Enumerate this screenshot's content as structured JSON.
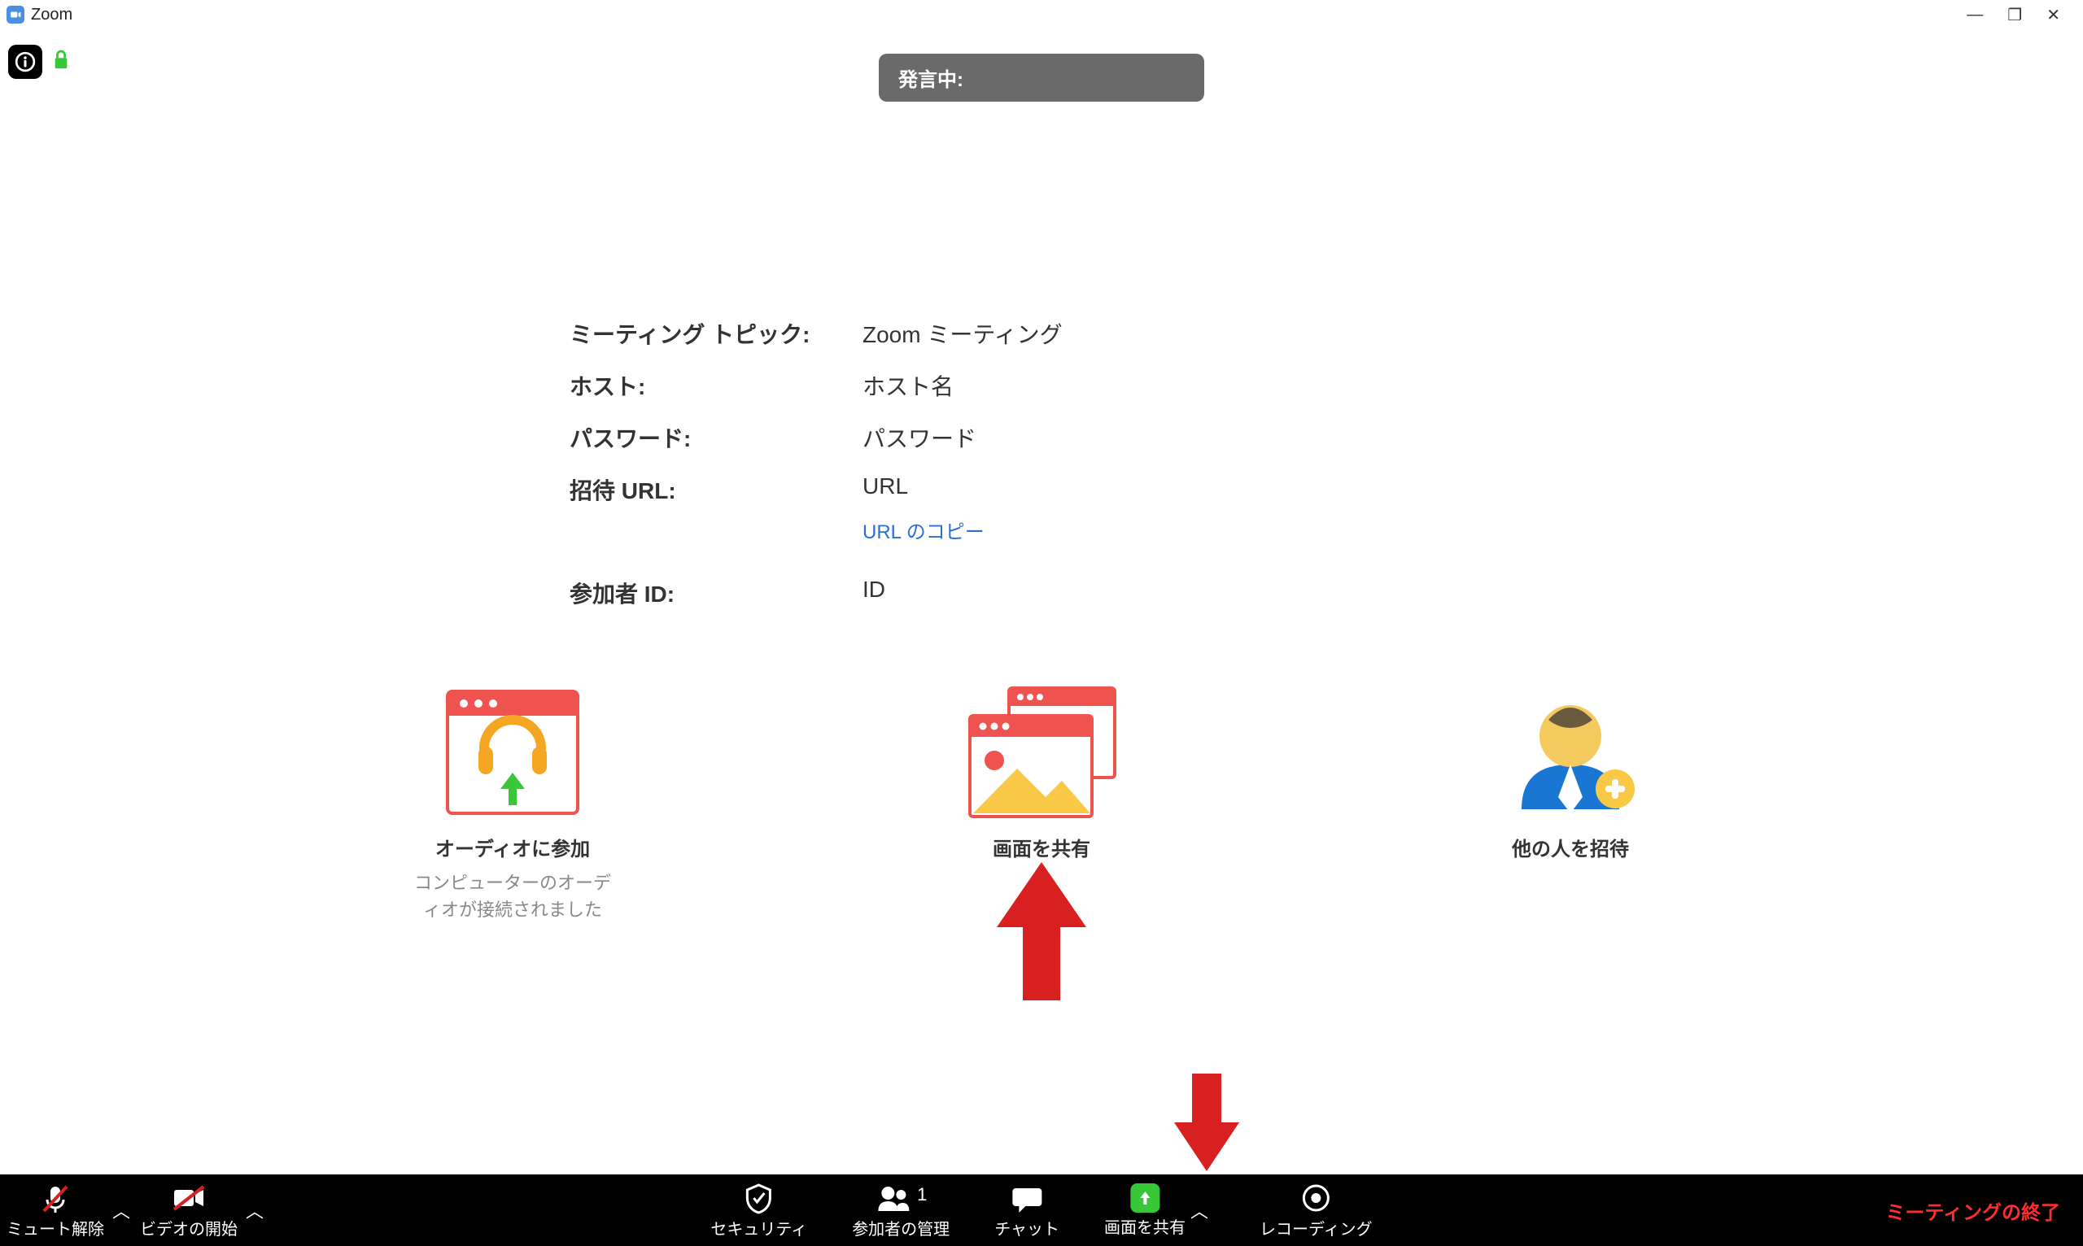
{
  "titlebar": {
    "app_name": "Zoom"
  },
  "speaking_label": "発言中:",
  "meeting": {
    "topic_label": "ミーティング トピック:",
    "topic_value": "Zoom ミーティング",
    "host_label": "ホスト:",
    "host_value": "ホスト名",
    "password_label": "パスワード:",
    "password_value": "パスワード",
    "invite_url_label": "招待 URL:",
    "invite_url_value": "URL",
    "url_copy": "URL のコピー",
    "participant_id_label": "参加者 ID:",
    "participant_id_value": "ID"
  },
  "tiles": {
    "join_audio": {
      "label": "オーディオに参加",
      "sub": "コンピューターのオーディオが接続されました"
    },
    "share_screen": {
      "label": "画面を共有"
    },
    "invite": {
      "label": "他の人を招待"
    }
  },
  "toolbar": {
    "unmute": "ミュート解除",
    "start_video": "ビデオの開始",
    "security": "セキュリティ",
    "participants": "参加者の管理",
    "participants_count": "1",
    "chat": "チャット",
    "share": "画面を共有",
    "record": "レコーディング",
    "end": "ミーティングの終了"
  }
}
